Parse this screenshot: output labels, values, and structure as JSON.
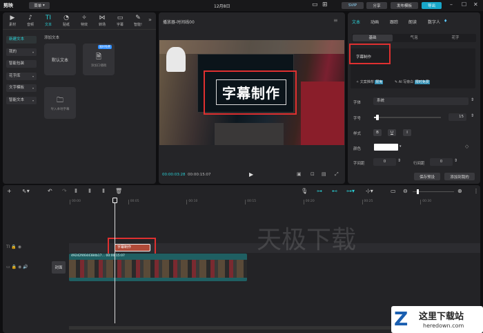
{
  "titlebar": {
    "app_name": "剪映",
    "menu_label": "菜单",
    "title": "12月8日",
    "svip": "SVIP",
    "share": "分享",
    "publish_template": "发布模板",
    "export": "导出"
  },
  "media_tabs": [
    {
      "label": "素材",
      "icon": "▶"
    },
    {
      "label": "音频",
      "icon": "♪"
    },
    {
      "label": "文本",
      "icon": "TI"
    },
    {
      "label": "贴纸",
      "icon": "◔"
    },
    {
      "label": "特效",
      "icon": "✧"
    },
    {
      "label": "转场",
      "icon": "⋈"
    },
    {
      "label": "字幕",
      "icon": "▭"
    },
    {
      "label": "智能!",
      "icon": "✎"
    }
  ],
  "text_panel": {
    "categories": [
      "新建文本",
      "我的",
      "智能包装",
      "花字库",
      "文字模板",
      "智能文本"
    ],
    "section_title": "添加文本",
    "default_text": "默认文本",
    "add_highlight": "添加口播稿",
    "badge": "限时免费",
    "import_local": "导入本地字幕"
  },
  "player": {
    "title": "播放器-时间线00",
    "caption": "字幕制作",
    "current_time": "00:00:03:28",
    "total_time": "00:00:15:07"
  },
  "inspector": {
    "tabs": [
      "文本",
      "动画",
      "跟踪",
      "朗读",
      "数字人"
    ],
    "subtabs": [
      "基础",
      "气泡",
      "花字"
    ],
    "text_value": "字幕制作",
    "smart_recommend": "文案推荐",
    "new_badge": "限免",
    "ai_write": "AI 写旁白",
    "ai_badge": "限时免费",
    "font_label": "字体",
    "font_value": "系统",
    "size_label": "字号",
    "size_value": "15",
    "size_fraction": 0.05,
    "style_label": "样式",
    "bold": "B",
    "underline": "U",
    "italic": "I",
    "color_label": "颜色",
    "color_value": "#ffffff",
    "char_spacing_label": "字间距",
    "char_spacing_value": "0",
    "line_spacing_label": "行间距",
    "line_spacing_value": "0",
    "save_preset": "保存预设",
    "add_to_mine": "添加到我的"
  },
  "timeline": {
    "ruler": [
      "00:00",
      "00:05",
      "00:10",
      "00:15",
      "00:20",
      "00:25",
      "00:30"
    ],
    "text_clip": "字幕制作",
    "video_clip_label": "49242f4644384b17…  00:00:15:07",
    "cover_label": "封面"
  },
  "watermarks": {
    "center": "天极下载",
    "corner_title": "这里下载站",
    "corner_url": "heredown.com"
  },
  "colors": {
    "accent": "#2ad0d6",
    "highlight_box": "#e03030",
    "text_clip": "#b04a38",
    "video_track": "#1f5f62"
  }
}
